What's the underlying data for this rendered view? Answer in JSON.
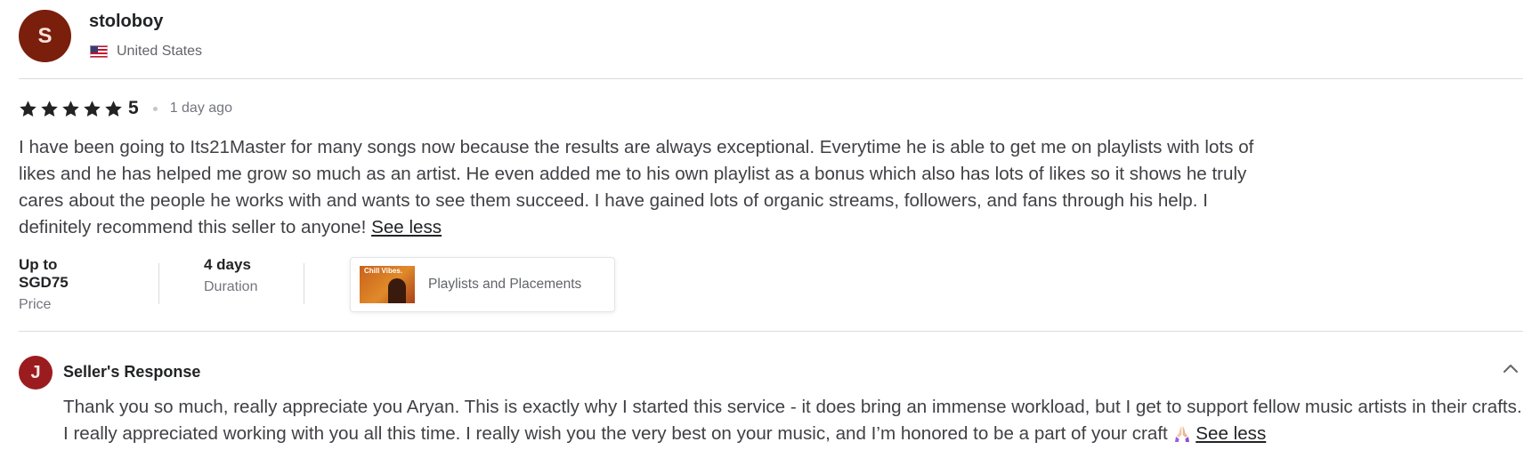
{
  "reviewer": {
    "initial": "S",
    "username": "stoloboy",
    "country": "United States",
    "flag_icon": "us-flag-icon"
  },
  "review": {
    "stars": 5,
    "score": "5",
    "time_ago": "1 day ago",
    "text": "I have been going to Its21Master for many songs now because the results are always exceptional. Everytime he is able to get me on playlists with lots of likes and he has helped me grow so much as an artist. He even added me to his own playlist as a bonus which also has lots of likes so it shows he truly cares about the people he works with and wants to see them succeed. I have gained lots of organic streams, followers, and fans through his help. I definitely recommend this seller to anyone!",
    "see_less": "See less"
  },
  "details": {
    "price_value": "Up to SGD75",
    "price_label": "Price",
    "duration_value": "4 days",
    "duration_label": "Duration",
    "gig_title": "Playlists and Placements",
    "gig_thumb_text": "Chill Vibes."
  },
  "seller_response": {
    "initial": "J",
    "title": "Seller's Response",
    "text": "Thank you so much, really appreciate you Aryan. This is exactly why I started this service - it does bring an immense workload, but I get to support fellow music artists in their crafts. I really appreciated working with you all this time. I really wish you the very best on your music, and I’m honored to be a part of your craft",
    "emoji_icon": "praying-hands-icon",
    "see_less": "See less",
    "collapse_icon": "chevron-up-icon"
  },
  "colors": {
    "reviewer_avatar": "#7a1f0c",
    "seller_avatar": "#9b1c1f",
    "text": "#404145",
    "muted": "#74767e",
    "divider": "#dadbdd"
  }
}
